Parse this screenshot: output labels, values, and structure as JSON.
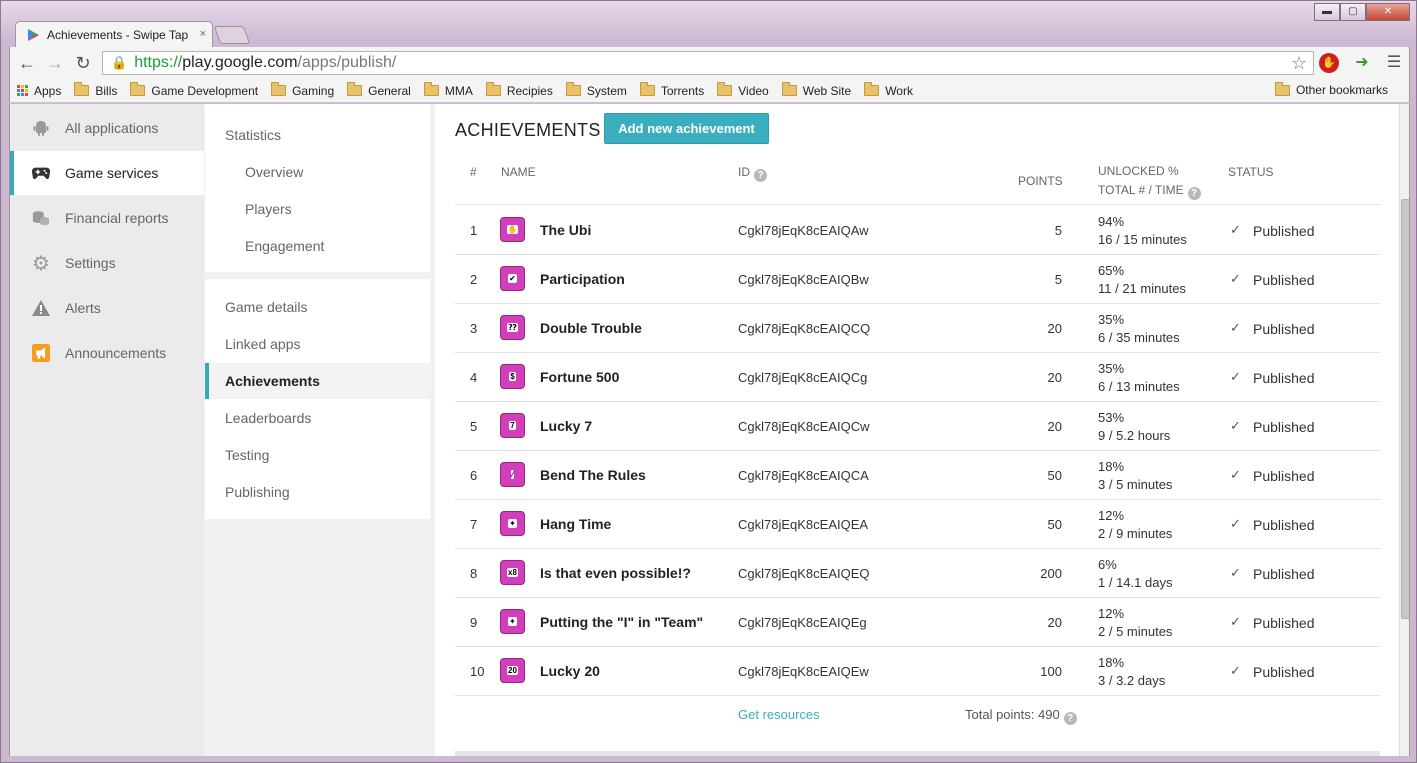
{
  "browser": {
    "tab_title": "Achievements - Swipe Tap",
    "tab_close": "×",
    "url_scheme": "https://",
    "url_host": "play.google.com",
    "url_path": "/apps/publish/",
    "window_controls": {
      "minimize": "▬",
      "maximize": "▢",
      "close": "✕"
    },
    "bookmarks": [
      "Apps",
      "Bills",
      "Game Development",
      "Gaming",
      "General",
      "MMA",
      "Recipies",
      "System",
      "Torrents",
      "Video",
      "Web Site",
      "Work"
    ],
    "other_bookmarks": "Other bookmarks",
    "apps_colors": [
      "#e94235",
      "#fbbc04",
      "#34a853",
      "#4285f4",
      "#e94235",
      "#fbbc04",
      "#34a853",
      "#4285f4",
      "#e94235"
    ]
  },
  "sidenav": {
    "accent": "#35a8bc",
    "items": [
      {
        "label": "All applications",
        "icon": "android-icon"
      },
      {
        "label": "Game services",
        "icon": "gamepad-icon",
        "active": true
      },
      {
        "label": "Financial reports",
        "icon": "coins-icon"
      },
      {
        "label": "Settings",
        "icon": "gear-icon"
      },
      {
        "label": "Alerts",
        "icon": "warning-icon"
      },
      {
        "label": "Announcements",
        "icon": "megaphone-icon"
      }
    ]
  },
  "subnav": {
    "statistics": "Statistics",
    "stats_items": [
      "Overview",
      "Players",
      "Engagement"
    ],
    "items": [
      "Game details",
      "Linked apps",
      "Achievements",
      "Leaderboards",
      "Testing",
      "Publishing"
    ],
    "active": "Achievements"
  },
  "main": {
    "title": "ACHIEVEMENTS",
    "add_button": "Add new achievement",
    "headers": {
      "num": "#",
      "name": "NAME",
      "id": "ID",
      "points": "POINTS",
      "unlocked": "UNLOCKED %",
      "total_time": "TOTAL # / TIME",
      "status": "STATUS",
      "help": "?"
    },
    "rows": [
      {
        "num": "1",
        "name": "The Ubi",
        "id": "Cgkl78jEqK8cEAIQAw",
        "points": "5",
        "pct": "94%",
        "time": "16 / 15 minutes",
        "status": "Published",
        "badge": "✋"
      },
      {
        "num": "2",
        "name": "Participation",
        "id": "Cgkl78jEqK8cEAIQBw",
        "points": "5",
        "pct": "65%",
        "time": "11 / 21 minutes",
        "status": "Published",
        "badge": "✔"
      },
      {
        "num": "3",
        "name": "Double Trouble",
        "id": "Cgkl78jEqK8cEAIQCQ",
        "points": "20",
        "pct": "35%",
        "time": "6 / 35 minutes",
        "status": "Published",
        "badge": "⁇"
      },
      {
        "num": "4",
        "name": "Fortune 500",
        "id": "Cgkl78jEqK8cEAIQCg",
        "points": "20",
        "pct": "35%",
        "time": "6 / 13 minutes",
        "status": "Published",
        "badge": "$"
      },
      {
        "num": "5",
        "name": "Lucky 7",
        "id": "Cgkl78jEqK8cEAIQCw",
        "points": "20",
        "pct": "53%",
        "time": "9 / 5.2 hours",
        "status": "Published",
        "badge": "7"
      },
      {
        "num": "6",
        "name": "Bend The Rules",
        "id": "Cgkl78jEqK8cEAIQCA",
        "points": "50",
        "pct": "18%",
        "time": "3 / 5 minutes",
        "status": "Published",
        "badge": "⁄"
      },
      {
        "num": "7",
        "name": "Hang Time",
        "id": "Cgkl78jEqK8cEAIQEA",
        "points": "50",
        "pct": "12%",
        "time": "2 / 9 minutes",
        "status": "Published",
        "badge": "✦"
      },
      {
        "num": "8",
        "name": "Is that even possible!?",
        "id": "Cgkl78jEqK8cEAIQEQ",
        "points": "200",
        "pct": "6%",
        "time": "1 / 14.1 days",
        "status": "Published",
        "badge": "x8"
      },
      {
        "num": "9",
        "name": "Putting the \"I\" in \"Team\"",
        "id": "Cgkl78jEqK8cEAIQEg",
        "points": "20",
        "pct": "12%",
        "time": "2 / 5 minutes",
        "status": "Published",
        "badge": "✦"
      },
      {
        "num": "10",
        "name": "Lucky 20",
        "id": "Cgkl78jEqK8cEAIQEw",
        "points": "100",
        "pct": "18%",
        "time": "3 / 3.2 days",
        "status": "Published",
        "badge": "20"
      }
    ],
    "get_resources": "Get resources",
    "total_points": "Total points: 490",
    "badge_color": "#d33fba",
    "button_color": "#3aaebf"
  }
}
